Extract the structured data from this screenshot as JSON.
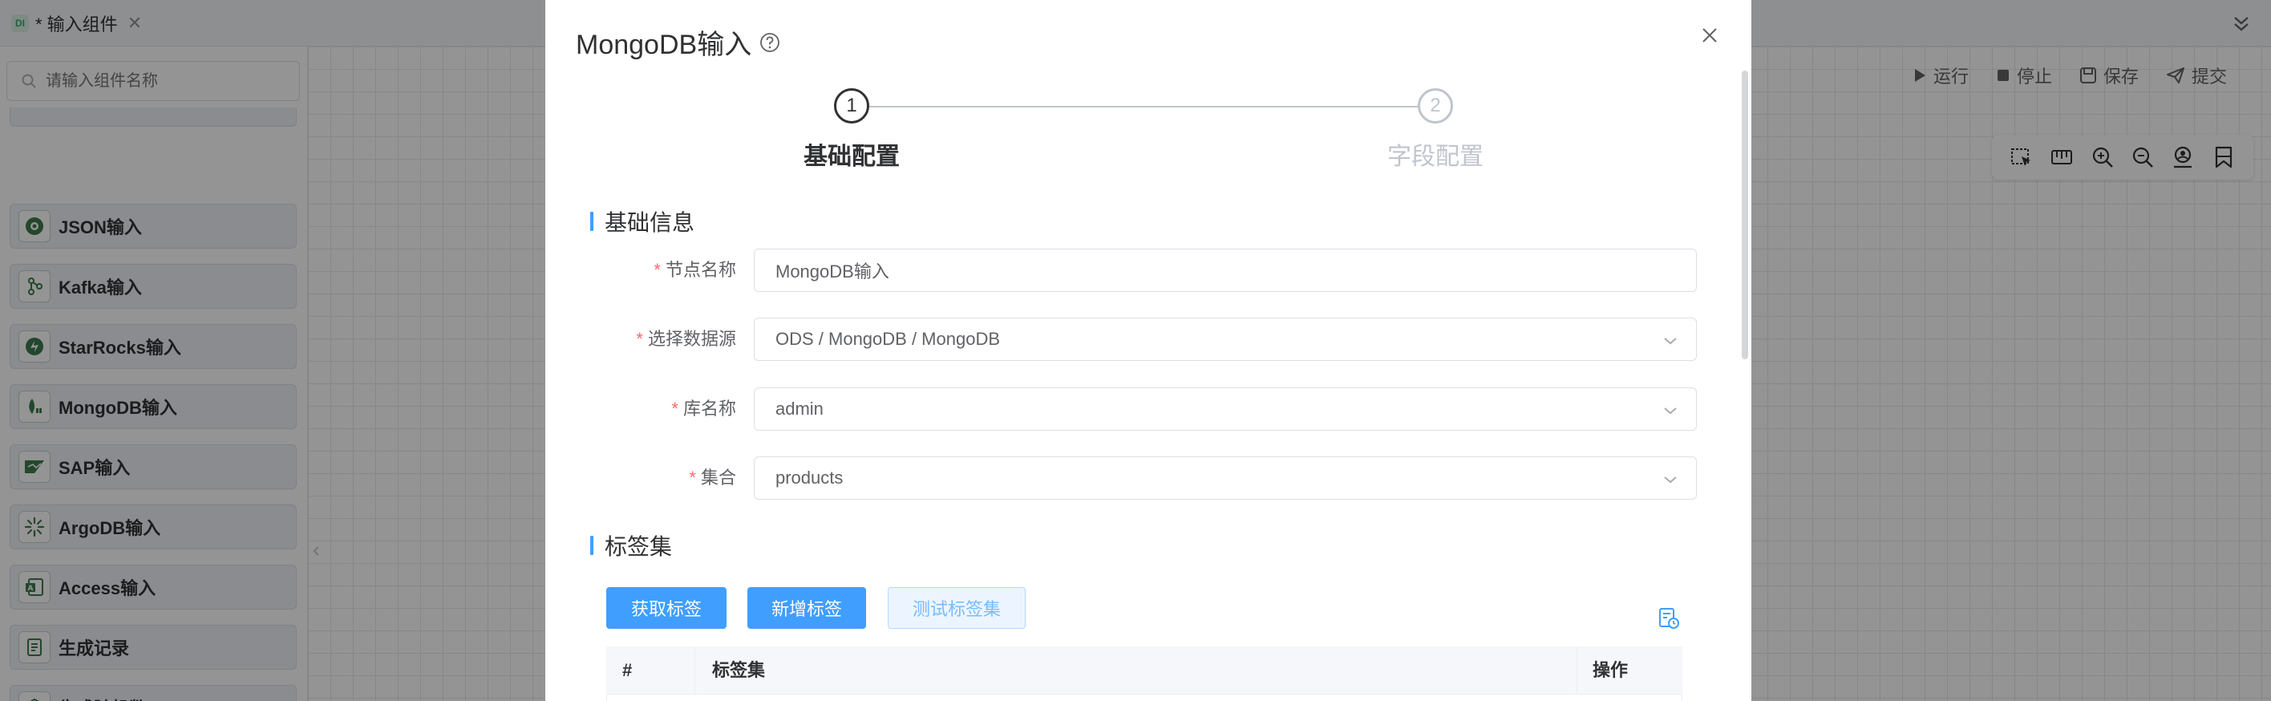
{
  "tabbar": {
    "tab_label": "* 输入组件",
    "tab_badge": "DI",
    "close_glyph": "✕"
  },
  "sidebar": {
    "search_placeholder": "请输入组件名称",
    "components": [
      {
        "label": "JSON输入",
        "icon": "json-icon"
      },
      {
        "label": "Kafka输入",
        "icon": "kafka-icon"
      },
      {
        "label": "StarRocks输入",
        "icon": "starrocks-icon"
      },
      {
        "label": "MongoDB输入",
        "icon": "mongodb-icon"
      },
      {
        "label": "SAP输入",
        "icon": "sap-icon"
      },
      {
        "label": "ArgoDB输入",
        "icon": "argodb-icon"
      },
      {
        "label": "Access输入",
        "icon": "access-icon"
      },
      {
        "label": "生成记录",
        "icon": "generate-records-icon"
      },
      {
        "label": "生成随机数",
        "icon": "random-number-icon"
      }
    ]
  },
  "toolbar": {
    "run": "运行",
    "stop": "停止",
    "save": "保存",
    "submit": "提交"
  },
  "modal": {
    "title": "MongoDB输入",
    "steps": [
      {
        "number": "1",
        "label": "基础配置",
        "active": true
      },
      {
        "number": "2",
        "label": "字段配置",
        "active": false
      }
    ],
    "basic_section": "基础信息",
    "fields": {
      "node_name": {
        "label": "节点名称",
        "value": "MongoDB输入",
        "required": true
      },
      "datasource": {
        "label": "选择数据源",
        "value": "ODS / MongoDB / MongoDB",
        "required": true
      },
      "database": {
        "label": "库名称",
        "value": "admin",
        "required": true
      },
      "collection": {
        "label": "集合",
        "value": "products",
        "required": true
      }
    },
    "tags_section": "标签集",
    "buttons": {
      "fetch_tags": "获取标签",
      "add_tag": "新增标签",
      "test_tagset": "测试标签集"
    },
    "table": {
      "columns": [
        "#",
        "标签集",
        "操作"
      ]
    }
  },
  "colors": {
    "primary": "#409eff",
    "required": "#f56c6c"
  }
}
